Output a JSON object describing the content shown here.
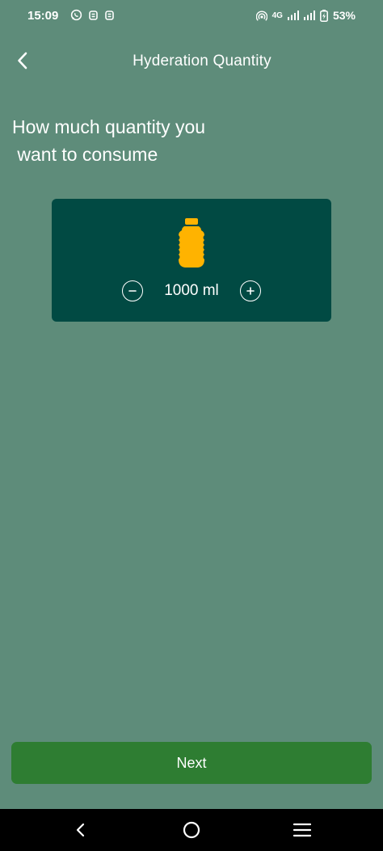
{
  "status_bar": {
    "time": "15:09",
    "network": "4G",
    "battery": "53%"
  },
  "app_bar": {
    "title": "Hyderation Quantity"
  },
  "question": "How much quantity you\n want to consume",
  "quantity": {
    "display": "1000 ml"
  },
  "next_button": {
    "label": "Next"
  },
  "colors": {
    "background": "#5e8c7a",
    "card": "#014a43",
    "bottle": "#ffb300",
    "next_button": "#2e7d32"
  },
  "icons": {
    "back": "chevron-left-icon",
    "bottle": "water-bottle-icon",
    "decrement": "minus-circle-icon",
    "increment": "plus-circle-icon"
  }
}
